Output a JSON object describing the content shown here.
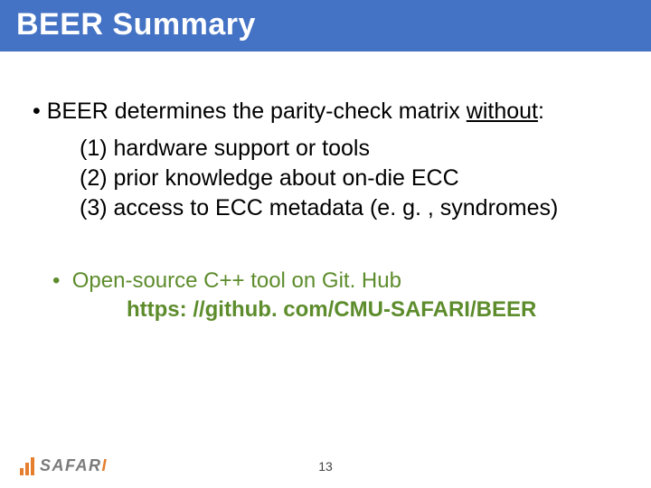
{
  "title": "BEER Summary",
  "bullet1": {
    "lead": "BEER determines the parity-check matrix ",
    "without": "without",
    "colon": ":",
    "items": [
      "(1) hardware support or tools",
      "(2) prior knowledge about on-die ECC",
      "(3) access to ECC metadata (e. g. , syndromes)"
    ]
  },
  "bullet2": {
    "text": "Open-source C++ tool on Git. Hub",
    "url": "https: //github. com/CMU-SAFARI/BEER"
  },
  "logo": {
    "text_main": "SAFAR",
    "text_last": "I"
  },
  "page_number": "13"
}
